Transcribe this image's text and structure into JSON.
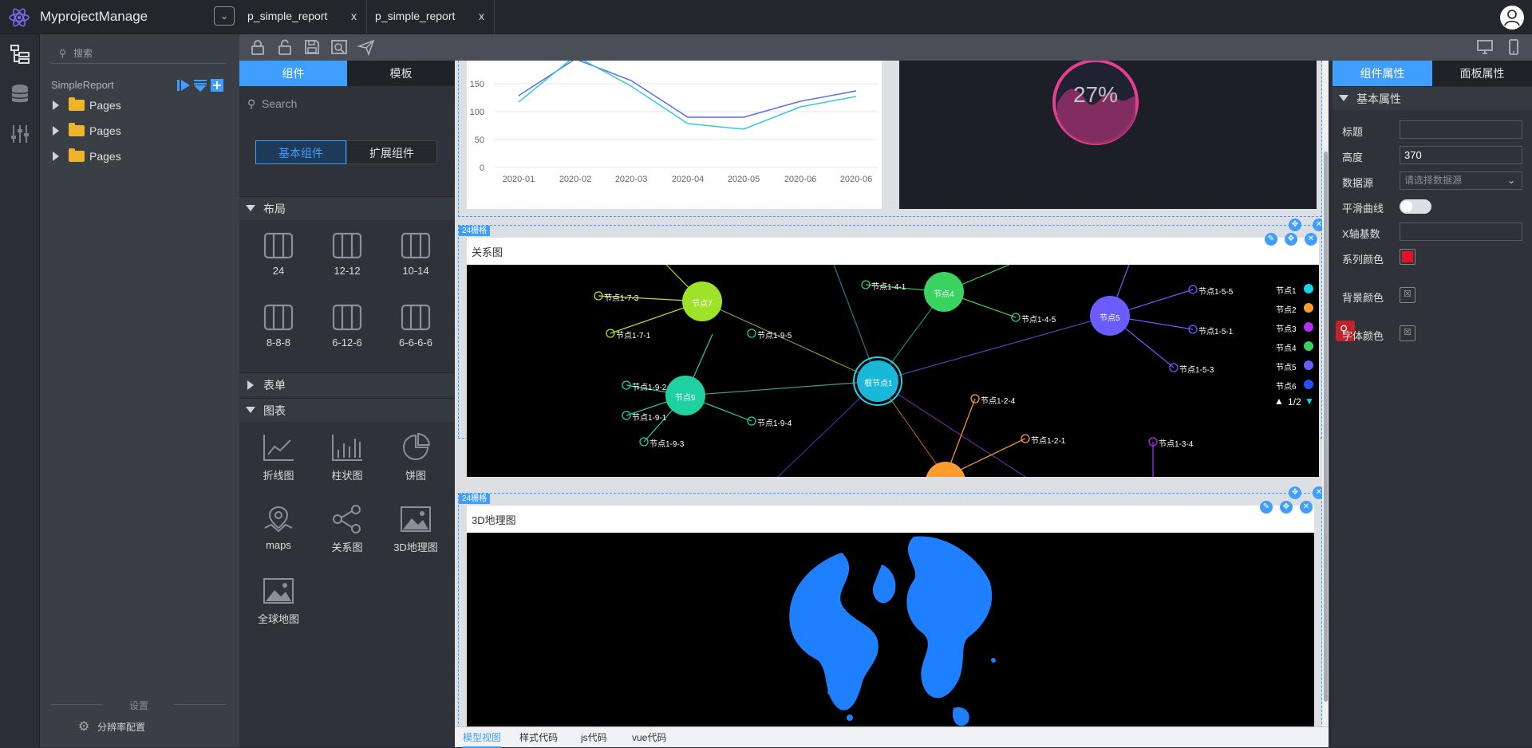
{
  "app": {
    "title": "MyprojectManage"
  },
  "file_tabs": [
    {
      "label": "p_simple_report",
      "close": "x"
    },
    {
      "label": "p_simple_report",
      "close": "x"
    }
  ],
  "tree": {
    "search_placeholder": "搜索",
    "section_title": "SimpleReport",
    "items": [
      {
        "label": "Pages"
      },
      {
        "label": "Pages"
      },
      {
        "label": "Pages"
      }
    ],
    "settings_label": "设置",
    "resolution_label": "分辨率配置"
  },
  "component_panel": {
    "tabs": [
      {
        "label": "组件"
      },
      {
        "label": "模板"
      }
    ],
    "search_placeholder": "Search",
    "subtabs": [
      {
        "label": "基本组件"
      },
      {
        "label": "扩展组件"
      }
    ],
    "sections": {
      "layout": "布局",
      "form": "表单",
      "chart": "图表"
    },
    "layouts": [
      "24",
      "12-12",
      "10-14",
      "8-8-8",
      "6-12-6",
      "6-6-6-6"
    ],
    "charts": [
      "折线图",
      "柱状图",
      "饼图",
      "maps",
      "关系图",
      "3D地理图",
      "全球地图"
    ]
  },
  "canvas": {
    "line_chart": {
      "y_ticks": [
        "150",
        "100",
        "50",
        "0"
      ],
      "x_ticks": [
        "2020-01",
        "2020-02",
        "2020-03",
        "2020-04",
        "2020-05",
        "2020-06",
        "2020-06"
      ]
    },
    "gauge": {
      "value_text": "27%"
    },
    "grid_badge_1": "24栅格",
    "grid_badge_2": "24栅格",
    "graph_card": {
      "title": "关系图",
      "nodes": {
        "root": "根节点1",
        "n7": "节点7",
        "n4": "节点4",
        "n5": "节点5",
        "n9": "节点9",
        "n2": "节点2",
        "l173": "节点1-7-3",
        "l171": "节点1-7-1",
        "l141": "节点1-4-1",
        "l145": "节点1-4-5",
        "l195": "节点1-9-5",
        "l155": "节点1-5-5",
        "l151": "节点1-5-1",
        "l153": "节点1-5-3",
        "l192": "节点1-9-2",
        "l191": "节点1-9-1",
        "l194": "节点1-9-4",
        "l193": "节点1-9-3",
        "l124": "节点1-2-4",
        "l121": "节点1-2-1",
        "l134": "节点1-3-4"
      },
      "legend": [
        {
          "name": "节点1",
          "color": "#19d3e8"
        },
        {
          "name": "节点2",
          "color": "#ff9b2f"
        },
        {
          "name": "节点3",
          "color": "#b22ff5"
        },
        {
          "name": "节点4",
          "color": "#3bd35f"
        },
        {
          "name": "节点5",
          "color": "#6a5cff"
        },
        {
          "name": "节点6",
          "color": "#2a4dff"
        }
      ],
      "legend_page": "1/2"
    },
    "geo_card": {
      "title": "3D地理图"
    }
  },
  "code_tabs": [
    "模型视图",
    "样式代码",
    "js代码",
    "vue代码"
  ],
  "props_panel": {
    "tabs": [
      "组件属性",
      "面板属性"
    ],
    "section": "基本属性",
    "rows": {
      "title_label": "标题",
      "height_label": "高度",
      "height_value": "370",
      "datasource_label": "数据源",
      "datasource_placeholder": "请选择数据源",
      "smooth_label": "平滑曲线",
      "xaxis_label": "X轴基数",
      "series_color_label": "系列颜色",
      "bg_color_label": "背景颜色",
      "font_color_label": "字体颜色"
    }
  }
}
